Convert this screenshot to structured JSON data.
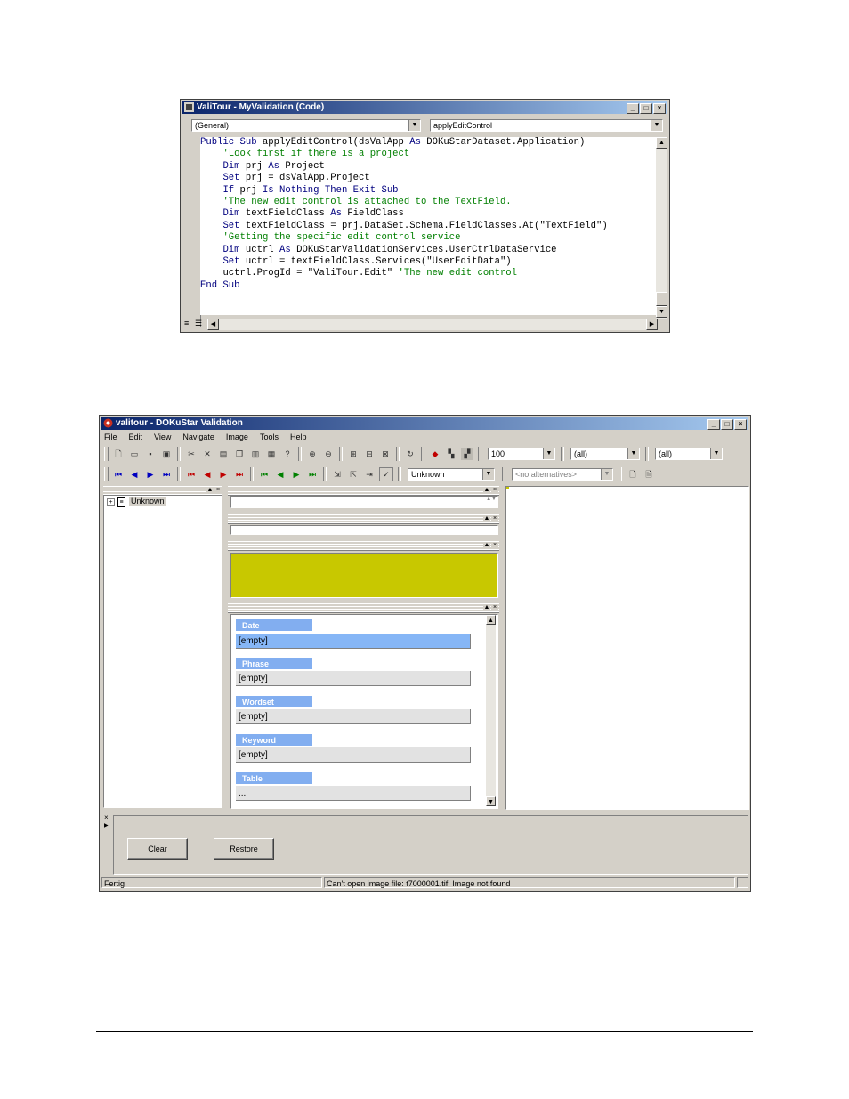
{
  "code_window": {
    "title": "ValiTour - MyValidation (Code)",
    "object_combo": "(General)",
    "procedure_combo": "applyEditControl",
    "lines": [
      {
        "indent": "",
        "parts": [
          {
            "t": "Public Sub",
            "c": "kw"
          },
          {
            "t": " applyEditControl(dsValApp ",
            "c": ""
          },
          {
            "t": "As",
            "c": "kw"
          },
          {
            "t": " DOKuStarDataset.Application)",
            "c": ""
          }
        ]
      },
      {
        "indent": "    ",
        "parts": [
          {
            "t": "'Look first if there is a project",
            "c": "cm"
          }
        ]
      },
      {
        "indent": "    ",
        "parts": [
          {
            "t": "Dim",
            "c": "kw"
          },
          {
            "t": " prj ",
            "c": ""
          },
          {
            "t": "As",
            "c": "kw"
          },
          {
            "t": " Project",
            "c": ""
          }
        ]
      },
      {
        "indent": "    ",
        "parts": [
          {
            "t": "Set",
            "c": "kw"
          },
          {
            "t": " prj = dsValApp.Project",
            "c": ""
          }
        ]
      },
      {
        "indent": "    ",
        "parts": [
          {
            "t": "If",
            "c": "kw"
          },
          {
            "t": " prj ",
            "c": ""
          },
          {
            "t": "Is Nothing Then Exit Sub",
            "c": "kw"
          }
        ]
      },
      {
        "indent": "",
        "parts": [
          {
            "t": "",
            "c": ""
          }
        ]
      },
      {
        "indent": "    ",
        "parts": [
          {
            "t": "'The new edit control is attached to the TextField.",
            "c": "cm"
          }
        ]
      },
      {
        "indent": "    ",
        "parts": [
          {
            "t": "Dim",
            "c": "kw"
          },
          {
            "t": " textFieldClass ",
            "c": ""
          },
          {
            "t": "As",
            "c": "kw"
          },
          {
            "t": " FieldClass",
            "c": ""
          }
        ]
      },
      {
        "indent": "    ",
        "parts": [
          {
            "t": "Set",
            "c": "kw"
          },
          {
            "t": " textFieldClass = prj.DataSet.Schema.FieldClasses.At(\"TextField\")",
            "c": ""
          }
        ]
      },
      {
        "indent": "",
        "parts": [
          {
            "t": "",
            "c": ""
          }
        ]
      },
      {
        "indent": "    ",
        "parts": [
          {
            "t": "'Getting the specific edit control service",
            "c": "cm"
          }
        ]
      },
      {
        "indent": "    ",
        "parts": [
          {
            "t": "Dim",
            "c": "kw"
          },
          {
            "t": " uctrl ",
            "c": ""
          },
          {
            "t": "As",
            "c": "kw"
          },
          {
            "t": " DOKuStarValidationServices.UserCtrlDataService",
            "c": ""
          }
        ]
      },
      {
        "indent": "    ",
        "parts": [
          {
            "t": "Set",
            "c": "kw"
          },
          {
            "t": " uctrl = textFieldClass.Services(\"UserEditData\")",
            "c": ""
          }
        ]
      },
      {
        "indent": "    ",
        "parts": [
          {
            "t": "uctrl.ProgId = \"ValiTour.Edit\" ",
            "c": ""
          },
          {
            "t": "'The new edit control",
            "c": "cm"
          }
        ]
      },
      {
        "indent": "",
        "parts": [
          {
            "t": "End Sub",
            "c": "kw"
          }
        ]
      }
    ]
  },
  "validation_window": {
    "title": "valitour - DOKuStar Validation",
    "menu": [
      "File",
      "Edit",
      "View",
      "Navigate",
      "Image",
      "Tools",
      "Help"
    ],
    "zoom_combo": "100",
    "filter_combo_1": "(all)",
    "filter_combo_2": "(all)",
    "class_combo": "Unknown",
    "alternatives_combo": "<no alternatives>",
    "tree_root": "Unknown",
    "image_color": "#c8c800",
    "fields": [
      {
        "name": "Date",
        "value": "[empty]",
        "active": true
      },
      {
        "name": "Phrase",
        "value": "[empty]",
        "active": false
      },
      {
        "name": "Wordset",
        "value": "[empty]",
        "active": false
      },
      {
        "name": "Keyword",
        "value": "[empty]",
        "active": false
      },
      {
        "name": "Table",
        "value": "...",
        "active": false
      }
    ],
    "buttons": {
      "clear": "Clear",
      "restore": "Restore"
    },
    "status_left": "Fertig",
    "status_message": "Can't open image file: t7000001.tif. Image not found"
  }
}
